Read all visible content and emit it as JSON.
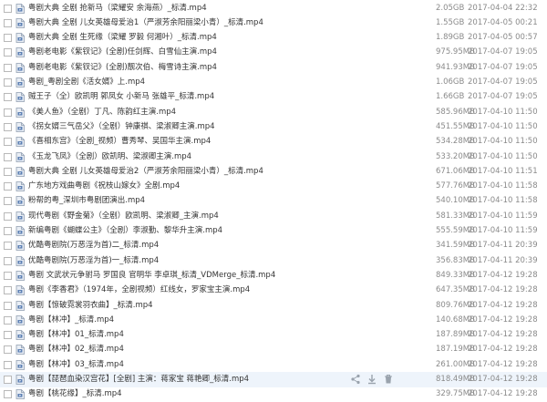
{
  "files": [
    {
      "name": "粤剧大典  全剧  抢新马（梁耀安 余海燕）_标清.mp4",
      "size": "2.05GB",
      "date": "2017-04-04 22:32"
    },
    {
      "name": "粤剧大典  全剧  儿女英雄母爱治1（严淑芳余阳丽梁小青）_标清.mp4",
      "size": "1.55GB",
      "date": "2017-04-05 00:21"
    },
    {
      "name": "粤剧大典  全剧  生死缘（梁耀 罗毅 何湘叶）_标清.mp4",
      "size": "1.89GB",
      "date": "2017-04-05 00:57"
    },
    {
      "name": "粤剧老电影《紫钗记》(全剧)任剑辉、白雪仙主演.mp4",
      "size": "975.95MB",
      "date": "2017-04-07 19:05"
    },
    {
      "name": "粤剧老电影《紫钗记》(全剧)靓次伯、梅雪诗主演.mp4",
      "size": "941.93MB",
      "date": "2017-04-07 19:05"
    },
    {
      "name": "粤剧_粤剧全剧《活女婿》上.mp4",
      "size": "1.06GB",
      "date": "2017-04-07 19:05"
    },
    {
      "name": "贼王子（全）欧凯明 郭凤女 小新马 张雄平_标清.mp4",
      "size": "1.66GB",
      "date": "2017-04-07 19:05"
    },
    {
      "name": "《美人鱼》（全剧）丁凡、陈韵红主演.mp4",
      "size": "585.96MB",
      "date": "2017-04-10 11:50"
    },
    {
      "name": "《拐女婿三气岳父》（全剧）钟康祺、梁淑卿主演.mp4",
      "size": "451.55MB",
      "date": "2017-04-10 11:50"
    },
    {
      "name": "《喜相东宫》（全剧_视频）曹秀琴、吴国华主演.mp4",
      "size": "534.28MB",
      "date": "2017-04-10 11:50"
    },
    {
      "name": "《玉龙飞凤》（全剧）欧凯明、梁淑卿主演.mp4",
      "size": "533.20MB",
      "date": "2017-04-10 11:50"
    },
    {
      "name": "粤剧大典  全剧  儿女英雄母爱治2（严淑芳余阳丽梁小青）_标清.mp4",
      "size": "671.06MB",
      "date": "2017-04-10 11:51"
    },
    {
      "name": "广东地方戏曲粤剧《祝枝山嫁女》全剧.mp4",
      "size": "577.76MB",
      "date": "2017-04-10 11:58"
    },
    {
      "name": "粉帮的粤_深圳市粤剧团演出.mp4",
      "size": "540.10MB",
      "date": "2017-04-10 11:58"
    },
    {
      "name": "现代粤剧《野金菊》（全剧）欧凯明、梁淑卿_主演.mp4",
      "size": "581.33MB",
      "date": "2017-04-10 11:59"
    },
    {
      "name": "新编粤剧《蝴蝶公主》（全剧）李淑勤、黎华升主演.mp4",
      "size": "555.59MB",
      "date": "2017-04-10 11:59"
    },
    {
      "name": "优酷粤剧院(万恶淫为首)二_标清.mp4",
      "size": "341.59MB",
      "date": "2017-04-11 20:39"
    },
    {
      "name": "优酷粤剧院(万恶淫为首)一_标清.mp4",
      "size": "356.83MB",
      "date": "2017-04-11 20:39"
    },
    {
      "name": "粤剧  文武状元争驸马  罗国良 官明华 李卓琪_标清_VDMerge_标清.mp4",
      "size": "849.33MB",
      "date": "2017-04-12 19:28"
    },
    {
      "name": "粤剧《李香君》（1974年，全剧视频）红线女，罗家宝主演.mp4",
      "size": "647.35MB",
      "date": "2017-04-12 19:28"
    },
    {
      "name": "粤剧【惊破霓裳羽衣曲】_标清.mp4",
      "size": "809.76MB",
      "date": "2017-04-12 19:28"
    },
    {
      "name": "粤剧【林冲】_标清.mp4",
      "size": "140.68MB",
      "date": "2017-04-12 19:28"
    },
    {
      "name": "粤剧【林冲】01_标清.mp4",
      "size": "187.89MB",
      "date": "2017-04-12 19:28"
    },
    {
      "name": "粤剧【林冲】02_标清.mp4",
      "size": "187.19MB",
      "date": "2017-04-12 19:28"
    },
    {
      "name": "粤剧【林冲】03_标清.mp4",
      "size": "261.00MB",
      "date": "2017-04-12 19:28"
    },
    {
      "name": "粤剧【琵琶血染汉宫花】[全剧] 主演：蒋家宝 蒋艳卿_标清.mp4",
      "size": "818.49MB",
      "date": "2017-04-12 19:28"
    },
    {
      "name": "粤剧【桃花缘】_标清.mp4",
      "size": "329.75MB",
      "date": "2017-04-12 19:28"
    }
  ],
  "hover_index": 25,
  "icons": {
    "file": "file-icon",
    "share": "share-icon",
    "download": "download-icon",
    "delete": "delete-icon"
  },
  "colors": {
    "hover_bg": "#eef4fb",
    "meta_text": "#8a8a8a"
  }
}
